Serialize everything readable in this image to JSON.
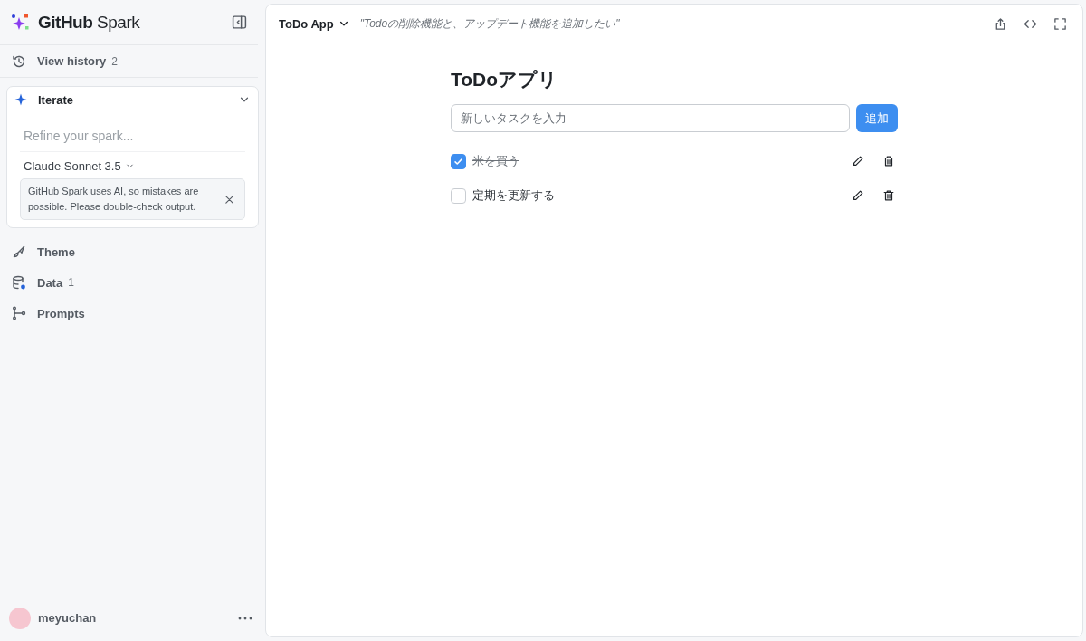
{
  "sidebar": {
    "brand": "**GitHub** Spark",
    "history": {
      "label": "View history",
      "count": "2"
    },
    "iterate": {
      "title": "Iterate",
      "expanded": true,
      "placeholder": "Refine your spark...",
      "model": "Claude Sonnet 3.5",
      "notice": "GitHub Spark uses AI, so mistakes are possible. Please double-check output."
    },
    "items": [
      {
        "label": "Theme",
        "dot": false
      },
      {
        "label": "Data",
        "count": "1",
        "dot": true
      },
      {
        "label": "Prompts",
        "dot": false
      }
    ],
    "user": {
      "name": "meyuchan"
    }
  },
  "header": {
    "app_name": "ToDo App",
    "prompt": "\"Todoの削除機能と、アップデート機能を追加したい\""
  },
  "app": {
    "title": "ToDoアプリ",
    "input_placeholder": "新しいタスクを入力",
    "add_button": "追加",
    "todos": [
      {
        "text": "米を買う",
        "checked": true
      },
      {
        "text": "定期を更新する",
        "checked": false
      }
    ]
  }
}
